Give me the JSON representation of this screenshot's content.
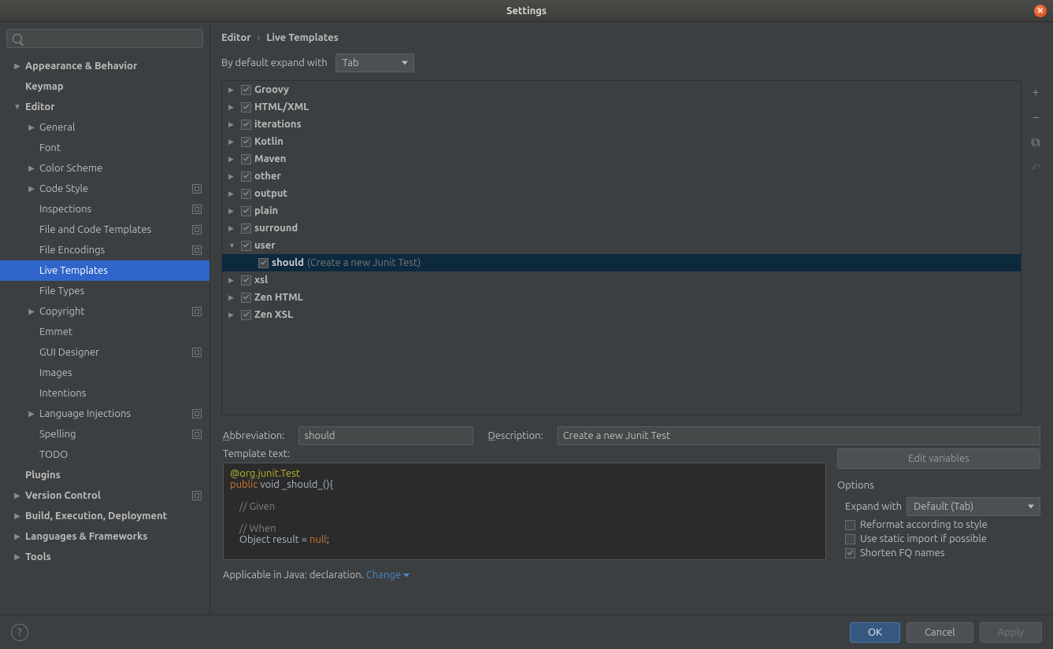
{
  "window": {
    "title": "Settings"
  },
  "search": {
    "placeholder": ""
  },
  "crumb": {
    "parent": "Editor",
    "sep": "›",
    "current": "Live Templates"
  },
  "default_expand": {
    "label": "By default expand with",
    "value": "Tab"
  },
  "sidebar": [
    {
      "label": "Appearance & Behavior",
      "bold": true,
      "arrow": "right",
      "indent": 0
    },
    {
      "label": "Keymap",
      "bold": true,
      "arrow": "none",
      "indent": 0
    },
    {
      "label": "Editor",
      "bold": true,
      "arrow": "down",
      "indent": 0
    },
    {
      "label": "General",
      "arrow": "right",
      "indent": 1
    },
    {
      "label": "Font",
      "arrow": "none",
      "indent": 1
    },
    {
      "label": "Color Scheme",
      "arrow": "right",
      "indent": 1
    },
    {
      "label": "Code Style",
      "arrow": "right",
      "indent": 1,
      "proj": true
    },
    {
      "label": "Inspections",
      "arrow": "none",
      "indent": 1,
      "proj": true
    },
    {
      "label": "File and Code Templates",
      "arrow": "none",
      "indent": 1,
      "proj": true
    },
    {
      "label": "File Encodings",
      "arrow": "none",
      "indent": 1,
      "proj": true
    },
    {
      "label": "Live Templates",
      "arrow": "none",
      "indent": 1,
      "sel": true
    },
    {
      "label": "File Types",
      "arrow": "none",
      "indent": 1
    },
    {
      "label": "Copyright",
      "arrow": "right",
      "indent": 1,
      "proj": true
    },
    {
      "label": "Emmet",
      "arrow": "none",
      "indent": 1
    },
    {
      "label": "GUI Designer",
      "arrow": "none",
      "indent": 1,
      "proj": true
    },
    {
      "label": "Images",
      "arrow": "none",
      "indent": 1
    },
    {
      "label": "Intentions",
      "arrow": "none",
      "indent": 1
    },
    {
      "label": "Language Injections",
      "arrow": "right",
      "indent": 1,
      "proj": true
    },
    {
      "label": "Spelling",
      "arrow": "none",
      "indent": 1,
      "proj": true
    },
    {
      "label": "TODO",
      "arrow": "none",
      "indent": 1
    },
    {
      "label": "Plugins",
      "bold": true,
      "arrow": "none",
      "indent": 0
    },
    {
      "label": "Version Control",
      "bold": true,
      "arrow": "right",
      "indent": 0,
      "proj": true
    },
    {
      "label": "Build, Execution, Deployment",
      "bold": true,
      "arrow": "right",
      "indent": 0
    },
    {
      "label": "Languages & Frameworks",
      "bold": true,
      "arrow": "right",
      "indent": 0
    },
    {
      "label": "Tools",
      "bold": true,
      "arrow": "right",
      "indent": 0
    }
  ],
  "templates": [
    {
      "label": "Groovy",
      "arrow": "right",
      "checked": true,
      "indent": 0
    },
    {
      "label": "HTML/XML",
      "arrow": "right",
      "checked": true,
      "indent": 0
    },
    {
      "label": "iterations",
      "arrow": "right",
      "checked": true,
      "indent": 0
    },
    {
      "label": "Kotlin",
      "arrow": "right",
      "checked": true,
      "indent": 0
    },
    {
      "label": "Maven",
      "arrow": "right",
      "checked": true,
      "indent": 0
    },
    {
      "label": "other",
      "arrow": "right",
      "checked": true,
      "indent": 0
    },
    {
      "label": "output",
      "arrow": "right",
      "checked": true,
      "indent": 0
    },
    {
      "label": "plain",
      "arrow": "right",
      "checked": true,
      "indent": 0
    },
    {
      "label": "surround",
      "arrow": "right",
      "checked": true,
      "indent": 0
    },
    {
      "label": "user",
      "arrow": "down",
      "checked": true,
      "indent": 0
    },
    {
      "label": "should",
      "desc": "(Create a new Junit Test)",
      "arrow": "none",
      "checked": true,
      "indent": 1,
      "sel": true
    },
    {
      "label": "xsl",
      "arrow": "right",
      "checked": true,
      "indent": 0
    },
    {
      "label": "Zen HTML",
      "arrow": "right",
      "checked": true,
      "indent": 0
    },
    {
      "label": "Zen XSL",
      "arrow": "right",
      "checked": true,
      "indent": 0
    }
  ],
  "toolbox": {
    "add": "+",
    "remove": "−",
    "copy": "⧉",
    "revert": "↶"
  },
  "form": {
    "abbrev_label": "Abbreviation:",
    "abbrev_value": "should",
    "desc_label": "Description:",
    "desc_value": "Create a new Junit Test",
    "template_label": "Template text:"
  },
  "code": {
    "l1a": "@org.junit.Test",
    "l2a": "public",
    "l2b": " void ",
    "l2c": "_should_",
    "l2d": "(){",
    "l3": "    // Given",
    "l4": "    // When",
    "l5a": "    Object ",
    "l5b": "result ",
    "l5c": "= ",
    "l5d": "null",
    "l5e": ";"
  },
  "rightcol": {
    "edit_vars": "Edit variables",
    "options": "Options",
    "expand_label": "Expand with",
    "expand_value": "Default (Tab)",
    "reformat": "Reformat according to style",
    "static_import": "Use static import if possible",
    "shorten": "Shorten FQ names"
  },
  "applicable": {
    "prefix": "Applicable in Java: declaration.  ",
    "change": "Change"
  },
  "footer": {
    "ok": "OK",
    "cancel": "Cancel",
    "apply": "Apply"
  }
}
